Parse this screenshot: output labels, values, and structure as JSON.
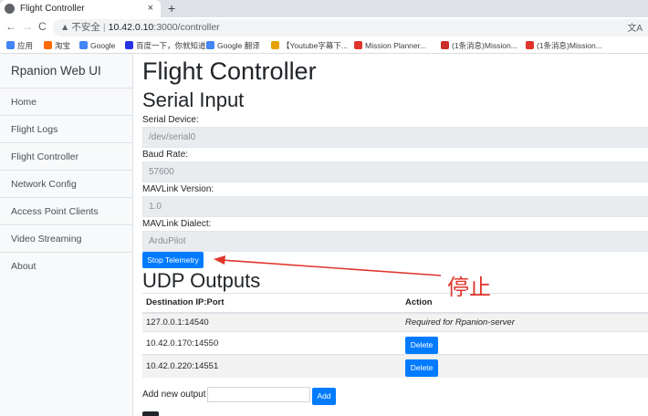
{
  "browser": {
    "tab_title": "Flight Controller",
    "tab_close": "×",
    "new_tab": "+",
    "nav_back": "←",
    "nav_forward": "→",
    "nav_reload": "C",
    "security_warning_icon": "▲",
    "security_text": "不安全",
    "url_host": "10.42.0.10",
    "url_path": ":3000/controller",
    "translate_icon": "文A",
    "bookmarks": [
      {
        "label": "应用",
        "color": "#4285f4"
      },
      {
        "label": "淘宝",
        "color": "#ff6a00"
      },
      {
        "label": "Google",
        "color": "#4285f4"
      },
      {
        "label": "百度一下，你就知道",
        "color": "#2932e1"
      },
      {
        "label": "Google 翻译",
        "color": "#4285f4"
      },
      {
        "label": "【Youtube字幕下...",
        "color": "#e6a100"
      },
      {
        "label": "Mission Planner...",
        "color": "#e0352b"
      },
      {
        "label": "(1条消息)Mission...",
        "color": "#c9302c"
      },
      {
        "label": "(1条消息)Mission...",
        "color": "#e0352b"
      }
    ]
  },
  "sidebar": {
    "brand": "Rpanion Web UI",
    "items": [
      {
        "label": "Home"
      },
      {
        "label": "Flight Logs"
      },
      {
        "label": "Flight Controller"
      },
      {
        "label": "Network Config"
      },
      {
        "label": "Access Point Clients"
      },
      {
        "label": "Video Streaming"
      },
      {
        "label": "About"
      }
    ]
  },
  "main": {
    "page_title": "Flight Controller",
    "serial_heading": "Serial Input",
    "serial_device_label": "Serial Device:",
    "serial_device_value": "/dev/serial0",
    "baud_label": "Baud Rate:",
    "baud_value": "57600",
    "mavlink_version_label": "MAVLink Version:",
    "mavlink_version_value": "1.0",
    "mavlink_dialect_label": "MAVLink Dialect:",
    "mavlink_dialect_value": "ArduPilot",
    "stop_button": "Stop Telemetry",
    "udp_heading": "UDP Outputs",
    "table_headers": [
      "Destination IP:Port",
      "Action"
    ],
    "udp_rows": [
      {
        "dest": "127.0.0.1:14540",
        "action_text": "Required for Rpanion-server",
        "has_button": false
      },
      {
        "dest": "10.42.0.170:14550",
        "action_text": "Delete",
        "has_button": true
      },
      {
        "dest": "10.42.0.220:14551",
        "action_text": "Delete",
        "has_button": true
      }
    ],
    "add_output_label": "Add new output",
    "add_button": "Add"
  },
  "annotation": {
    "text": "停止",
    "color": "#e0352b"
  }
}
